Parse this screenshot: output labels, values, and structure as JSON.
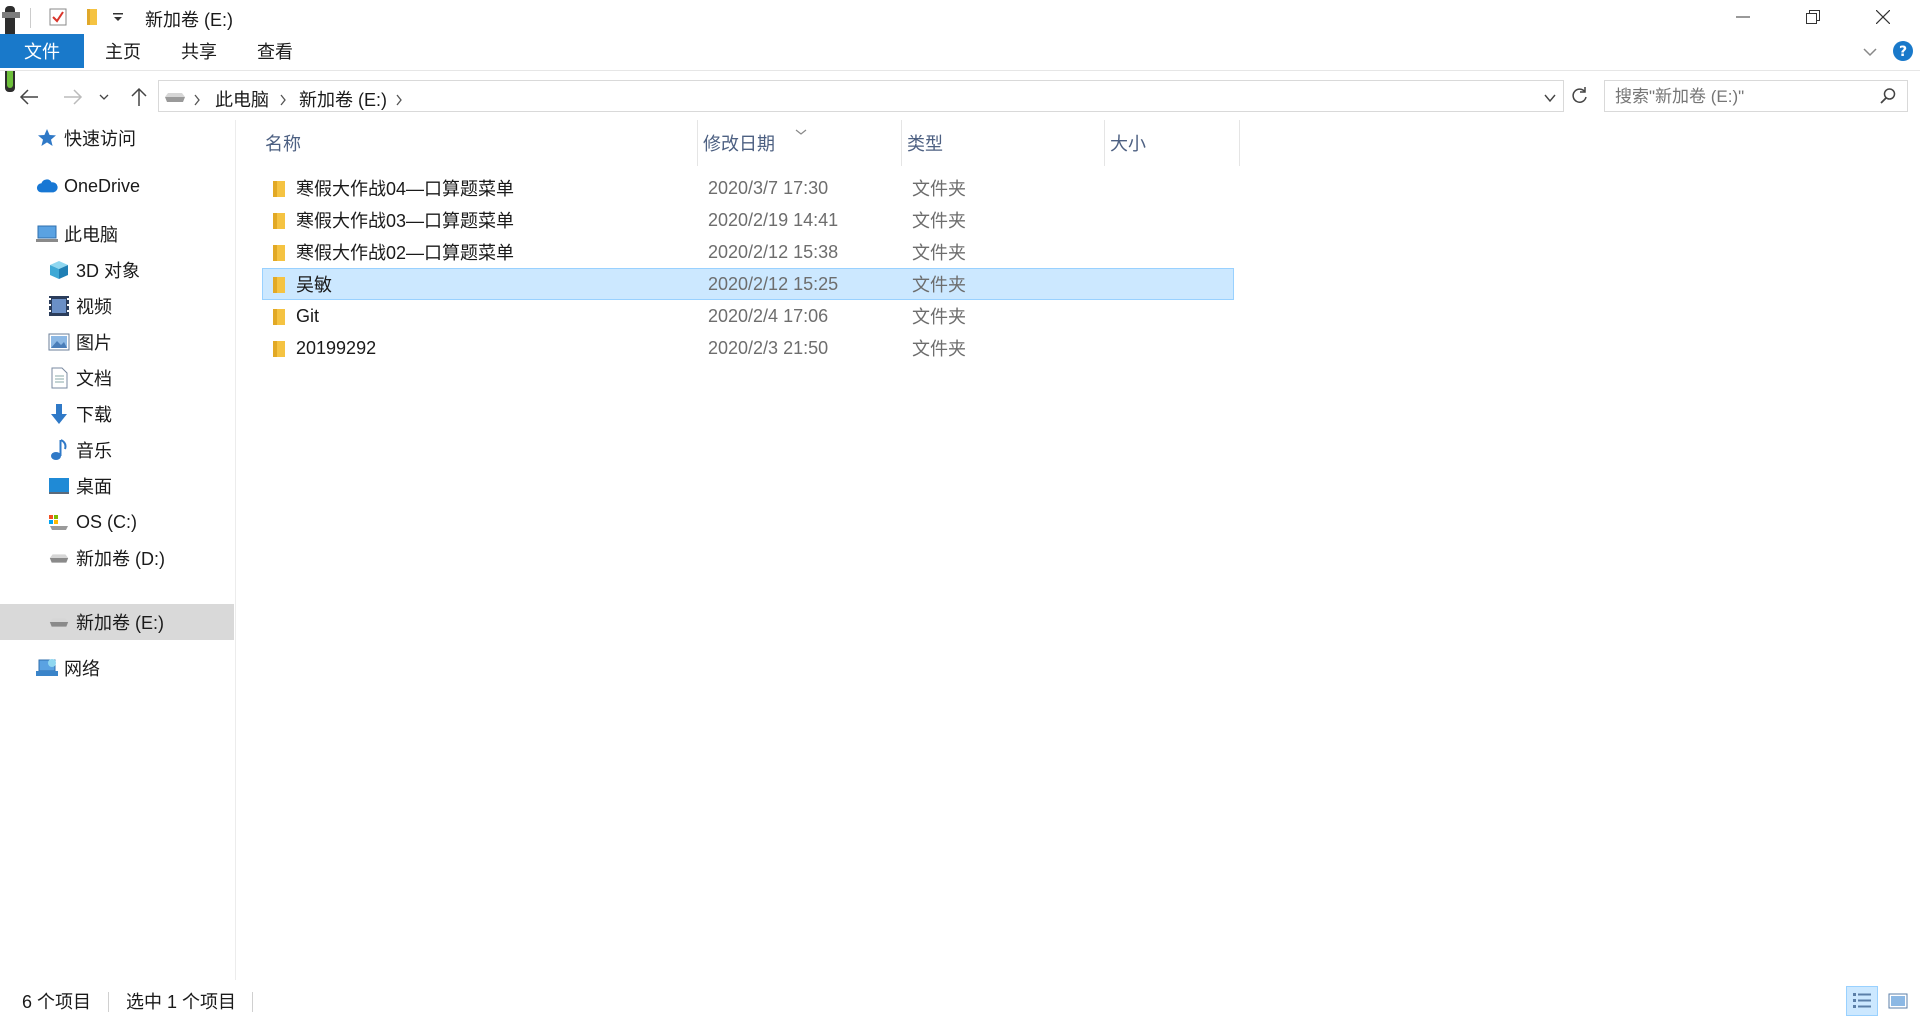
{
  "window": {
    "title": "新加卷 (E:)"
  },
  "ribbon": {
    "tabs": [
      {
        "label": "文件",
        "active": true
      },
      {
        "label": "主页"
      },
      {
        "label": "共享"
      },
      {
        "label": "查看"
      }
    ]
  },
  "address": {
    "crumbs": [
      "此电脑",
      "新加卷 (E:)"
    ]
  },
  "search": {
    "placeholder": "搜索\"新加卷 (E:)\""
  },
  "sidebar": {
    "items": [
      {
        "label": "快速访问",
        "icon": "star-icon"
      },
      {
        "label": "OneDrive",
        "icon": "cloud-icon"
      },
      {
        "label": "此电脑",
        "icon": "computer-icon"
      },
      {
        "label": "3D 对象",
        "icon": "cube-icon"
      },
      {
        "label": "视频",
        "icon": "video-icon"
      },
      {
        "label": "图片",
        "icon": "picture-icon"
      },
      {
        "label": "文档",
        "icon": "document-icon"
      },
      {
        "label": "下载",
        "icon": "download-icon"
      },
      {
        "label": "音乐",
        "icon": "music-icon"
      },
      {
        "label": "桌面",
        "icon": "desktop-icon"
      },
      {
        "label": "OS (C:)",
        "icon": "os-drive-icon"
      },
      {
        "label": "新加卷 (D:)",
        "icon": "drive-icon"
      },
      {
        "label": "新加卷 (E:)",
        "icon": "drive-icon",
        "selected": true
      },
      {
        "label": "网络",
        "icon": "network-icon"
      }
    ]
  },
  "columns": {
    "name": "名称",
    "date": "修改日期",
    "type": "类型",
    "size": "大小"
  },
  "files": [
    {
      "name": "寒假大作战04—口算题菜单",
      "date": "2020/3/7 17:30",
      "type": "文件夹"
    },
    {
      "name": "寒假大作战03—口算题菜单",
      "date": "2020/2/19 14:41",
      "type": "文件夹"
    },
    {
      "name": "寒假大作战02—口算题菜单",
      "date": "2020/2/12 15:38",
      "type": "文件夹"
    },
    {
      "name": "吴敏",
      "date": "2020/2/12 15:25",
      "type": "文件夹",
      "selected": true
    },
    {
      "name": "Git",
      "date": "2020/2/4 17:06",
      "type": "文件夹"
    },
    {
      "name": "20199292",
      "date": "2020/2/3 21:50",
      "type": "文件夹"
    }
  ],
  "status": {
    "count": "6 个项目",
    "selected": "选中 1 个项目"
  },
  "colors": {
    "accent": "#1979ca",
    "selection": "#cce8ff",
    "header_text": "#4d6082",
    "folder": "#f5c342"
  }
}
